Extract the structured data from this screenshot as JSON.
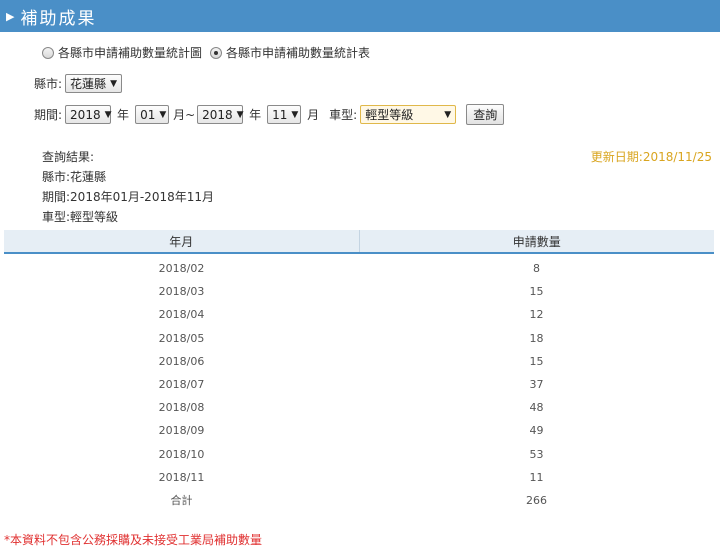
{
  "header": {
    "title": "補助成果"
  },
  "view_options": [
    {
      "label": "各縣市申請補助數量統計圖",
      "checked": false
    },
    {
      "label": "各縣市申請補助數量統計表",
      "checked": true
    }
  ],
  "county": {
    "label": "縣市:",
    "selected": "花蓮縣"
  },
  "period": {
    "label": "期間:",
    "start_year": "2018",
    "year_suffix": "年",
    "start_month": "01",
    "month_suffix_tilde": "月~",
    "end_year": "2018",
    "year_suffix2": "年",
    "end_month": "11",
    "month_suffix": "月"
  },
  "vehicle_type": {
    "label": "車型:",
    "selected": "輕型等級"
  },
  "query_button": "查詢",
  "result": {
    "heading": "查詢結果:",
    "county_line": "縣市:花蓮縣",
    "period_line": "期間:2018年01月-2018年11月",
    "type_line": "車型:輕型等級"
  },
  "update_date": "更新日期:2018/11/25",
  "table": {
    "headers": [
      "年月",
      "申請數量"
    ],
    "rows": [
      [
        "2018/02",
        "8"
      ],
      [
        "2018/03",
        "15"
      ],
      [
        "2018/04",
        "12"
      ],
      [
        "2018/05",
        "18"
      ],
      [
        "2018/06",
        "15"
      ],
      [
        "2018/07",
        "37"
      ],
      [
        "2018/08",
        "48"
      ],
      [
        "2018/09",
        "49"
      ],
      [
        "2018/10",
        "53"
      ],
      [
        "2018/11",
        "11"
      ],
      [
        "合計",
        "266"
      ]
    ]
  },
  "note": "*本資料不包含公務採購及未接受工業局補助數量"
}
